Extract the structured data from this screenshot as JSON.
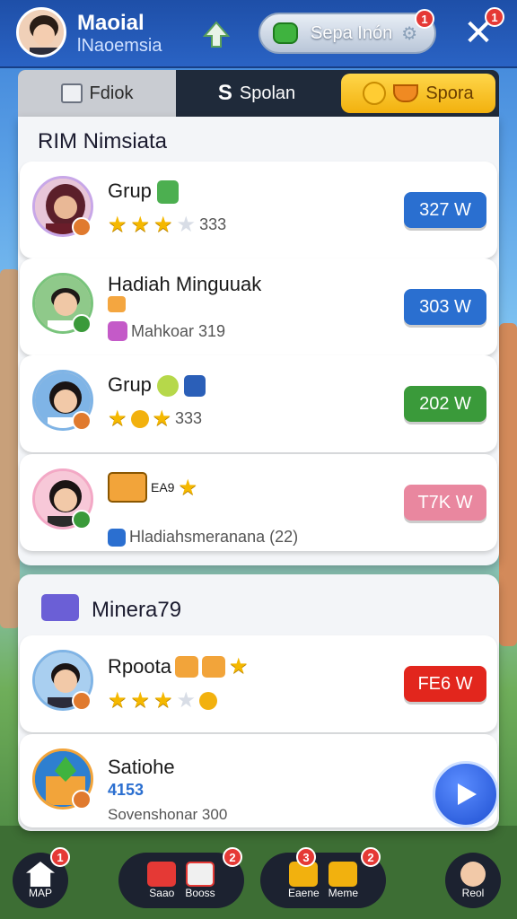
{
  "header": {
    "player_name": "Maoial",
    "player_sub": "lNaoemsia",
    "pill_label": "Sepa Inón",
    "notif_badge": "1",
    "close_badge": "1"
  },
  "tabs": [
    {
      "label": "Fdiok"
    },
    {
      "label": "Spolan"
    },
    {
      "label": "Spora"
    }
  ],
  "section1": {
    "title": "RIM Nimsiata",
    "items": [
      {
        "name": "Grup",
        "sub": "333",
        "value": "327 W",
        "color": "#2a6fd0"
      },
      {
        "name": "Hadiah Minguuak",
        "sub": "Mahkoar 319",
        "value": "303 W",
        "color": "#2a6fd0"
      },
      {
        "name": "Grup",
        "sub": "333",
        "value": "202 W",
        "color": "#3a9a3a"
      },
      {
        "name": "EA9",
        "sub": "Hladiahsmeranana (22)",
        "value": "T7K W",
        "color": "#e9879f"
      }
    ]
  },
  "section2": {
    "title": "Minera79",
    "items": [
      {
        "name": "Rpoota",
        "value": "FE6 W",
        "color": "#e2261d"
      },
      {
        "name": "Satiohe",
        "sub_top": "4153",
        "sub": "Sovenshonar 300"
      }
    ]
  },
  "bottom_nav": [
    {
      "label": "MAP",
      "badge": "1"
    },
    {
      "label": "Saao",
      "badge": ""
    },
    {
      "label": "Booss",
      "badge": "2"
    },
    {
      "label": "Eaene",
      "badge": "3"
    },
    {
      "label": "Meme",
      "badge": "2"
    },
    {
      "label": "Reol",
      "badge": ""
    }
  ]
}
